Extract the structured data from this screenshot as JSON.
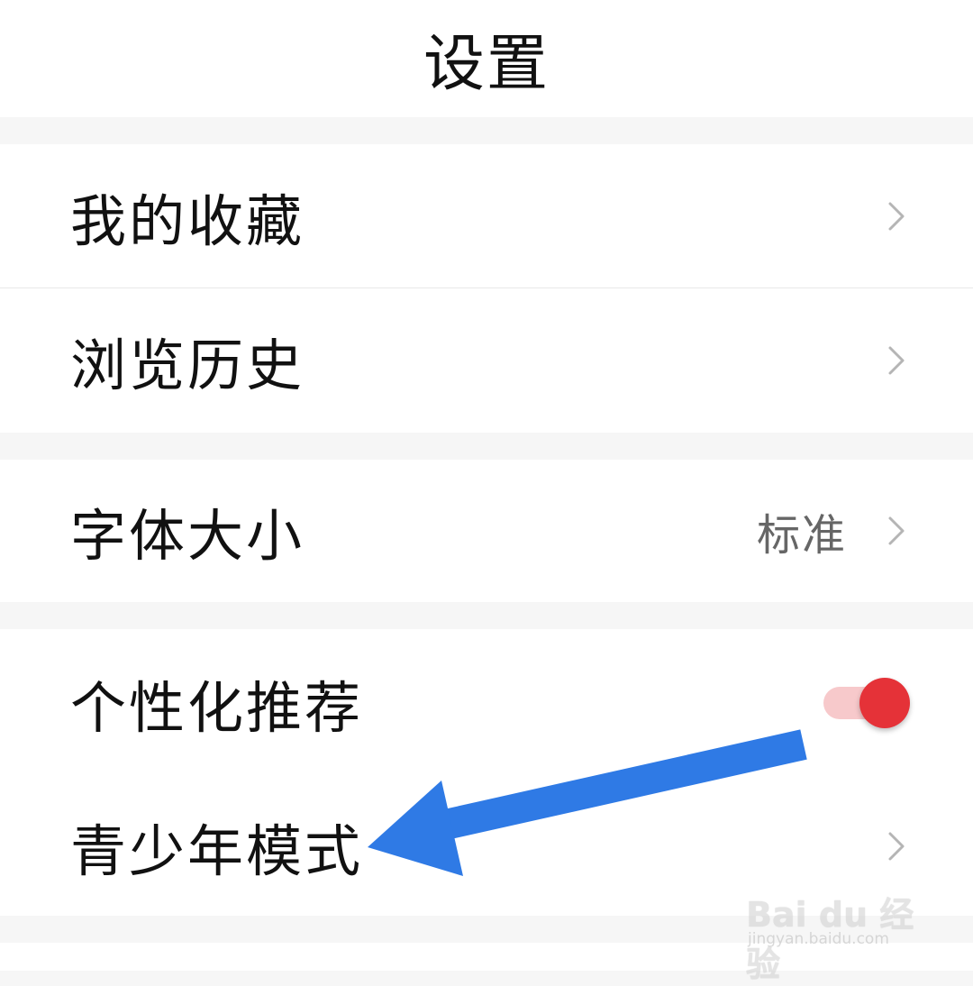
{
  "header": {
    "title": "设置"
  },
  "groups": [
    {
      "items": [
        {
          "label": "我的收藏"
        },
        {
          "label": "浏览历史"
        }
      ]
    },
    {
      "items": [
        {
          "label": "字体大小",
          "value": "标准"
        }
      ]
    },
    {
      "items": [
        {
          "label": "个性化推荐",
          "toggle_on": true
        },
        {
          "label": "青少年模式"
        }
      ]
    }
  ],
  "colors": {
    "accent": "#e53238",
    "toggle_track": "#f7c9cb",
    "annotation_arrow": "#2f7ae5"
  },
  "watermark": {
    "logo": "Bai du 经验",
    "url": "jingyan.baidu.com"
  }
}
